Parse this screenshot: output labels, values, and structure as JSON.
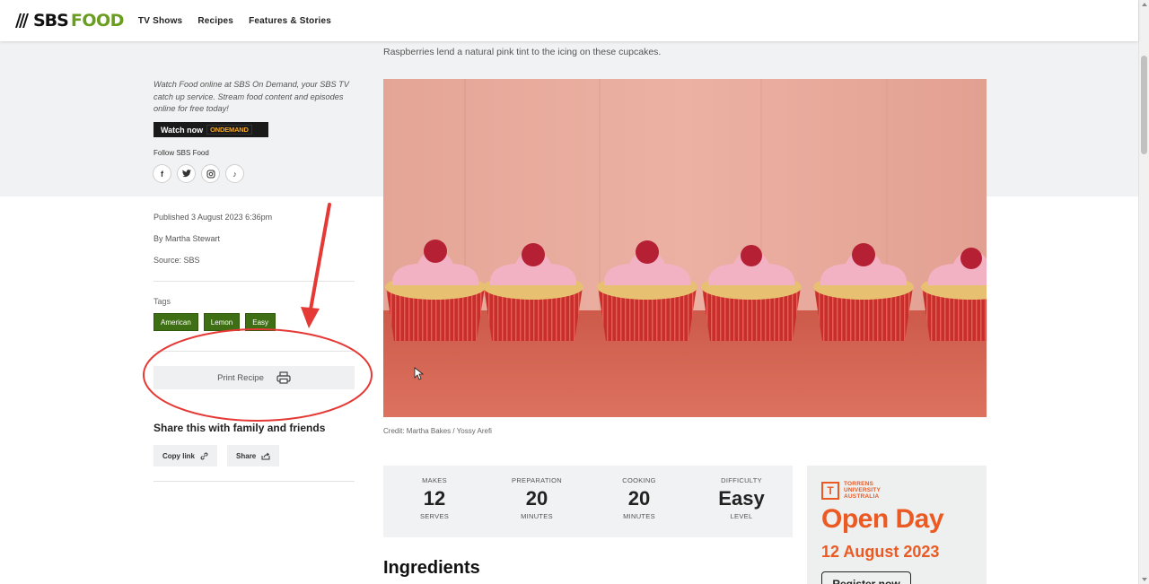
{
  "header": {
    "logo_sbs": "SBS",
    "logo_food": "FOOD",
    "nav": [
      "TV Shows",
      "Recipes",
      "Features & Stories"
    ]
  },
  "sidebar": {
    "promo_text": "Watch Food online at SBS On Demand, your SBS TV catch up service. Stream food content and episodes online for free today!",
    "watch_label": "Watch now",
    "ondemand_badge": "ONDEMAND",
    "follow_label": "Follow SBS Food",
    "socials": [
      {
        "name": "facebook-icon",
        "glyph": "f"
      },
      {
        "name": "twitter-icon",
        "glyph": "t"
      },
      {
        "name": "instagram-icon",
        "glyph": "◎"
      },
      {
        "name": "tiktok-icon",
        "glyph": "♪"
      }
    ],
    "published": "Published 3 August 2023 6:36pm",
    "author": "By Martha Stewart",
    "source": "Source: SBS",
    "tags_label": "Tags",
    "tags": [
      "American",
      "Lemon",
      "Easy"
    ],
    "print_label": "Print Recipe",
    "share_title": "Share this with family and friends",
    "copy_link_label": "Copy link",
    "share_label": "Share"
  },
  "main": {
    "caption": "Raspberries lend a natural pink tint to the icing on these cupcakes.",
    "credit": "Credit: Martha Bakes / Yossy Arefi",
    "stats": [
      {
        "label": "MAKES",
        "value": "12",
        "unit": "SERVES"
      },
      {
        "label": "PREPARATION",
        "value": "20",
        "unit": "MINUTES"
      },
      {
        "label": "COOKING",
        "value": "20",
        "unit": "MINUTES"
      },
      {
        "label": "DIFFICULTY",
        "value": "Easy",
        "unit": "LEVEL"
      }
    ],
    "ingredients_heading": "Ingredients"
  },
  "ad": {
    "logo_line1": "TORRENS",
    "logo_line2": "UNIVERSITY",
    "logo_line3": "AUSTRALIA",
    "title": "Open Day",
    "date": "12 August 2023",
    "button": "Register now"
  },
  "colors": {
    "brand_green": "#6b9e1f",
    "tag_green": "#3f6f14",
    "annotation_red": "#e53935",
    "ad_orange": "#ec5a24",
    "cupcake_frosting": "#f3b2c4",
    "cupcake_liner": "#c9312f",
    "backdrop_pink": "#e7a99b",
    "tablecloth": "#d86a58"
  }
}
